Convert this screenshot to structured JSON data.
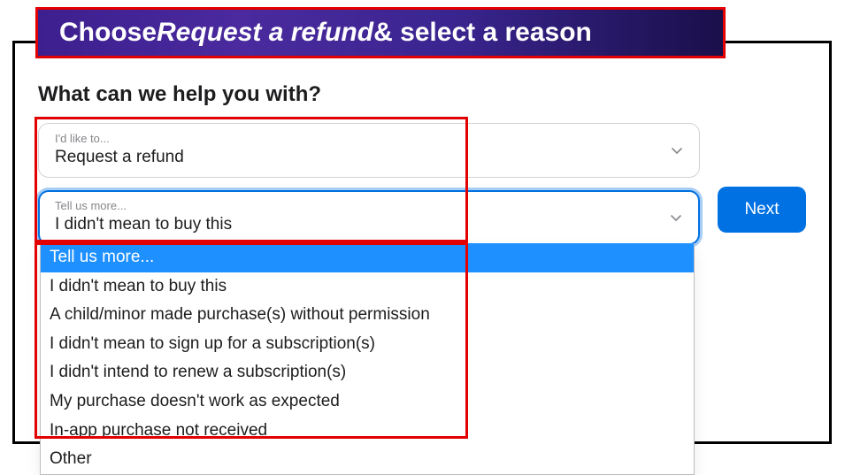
{
  "banner": {
    "prefix": "Choose ",
    "italic": "Request a refund",
    "suffix": " & select a reason"
  },
  "heading": "What can we help you with?",
  "select1": {
    "label": "I'd like to...",
    "value": "Request a refund"
  },
  "select2": {
    "label": "Tell us more...",
    "value": "I didn't mean to buy this"
  },
  "dropdown": {
    "options": [
      "Tell us more...",
      "I didn't mean to buy this",
      "A child/minor made purchase(s) without permission",
      "I didn't mean to sign up for a subscription(s)",
      "I didn't intend to renew a subscription(s)",
      "My purchase doesn't work as expected",
      "In-app purchase not received",
      "Other"
    ],
    "highlighted_index": 0
  },
  "next_label": "Next"
}
